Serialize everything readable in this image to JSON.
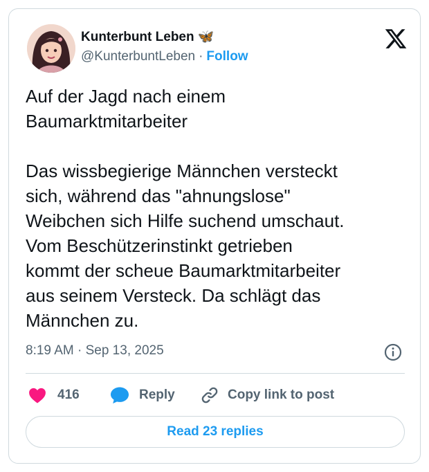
{
  "author": {
    "display_name": "Kunterbunt Leben 🦋",
    "handle": "@KunterbuntLeben",
    "separator": "·",
    "follow_label": "Follow"
  },
  "platform_icon": "x-logo-icon",
  "post": {
    "text": "Auf der Jagd nach einem\nBaumarktmitarbeiter\n\nDas wissbegierige Männchen versteckt\nsich, während das \"ahnungslose\"\nWeibchen sich Hilfe suchend umschaut.\nVom Beschützerinstinkt getrieben\nkommt der scheue Baumarktmitarbeiter\naus seinem Versteck. Da schlägt das\nMännchen zu.",
    "timestamp": "8:19 AM · Sep 13, 2025"
  },
  "actions": {
    "like_count": "416",
    "reply_label": "Reply",
    "copy_label": "Copy link to post"
  },
  "read_replies_label": "Read 23 replies",
  "colors": {
    "accent": "#1d9bf0",
    "like": "#f91880",
    "text": "#0f1419",
    "muted": "#536471",
    "border": "#cfd9de"
  }
}
